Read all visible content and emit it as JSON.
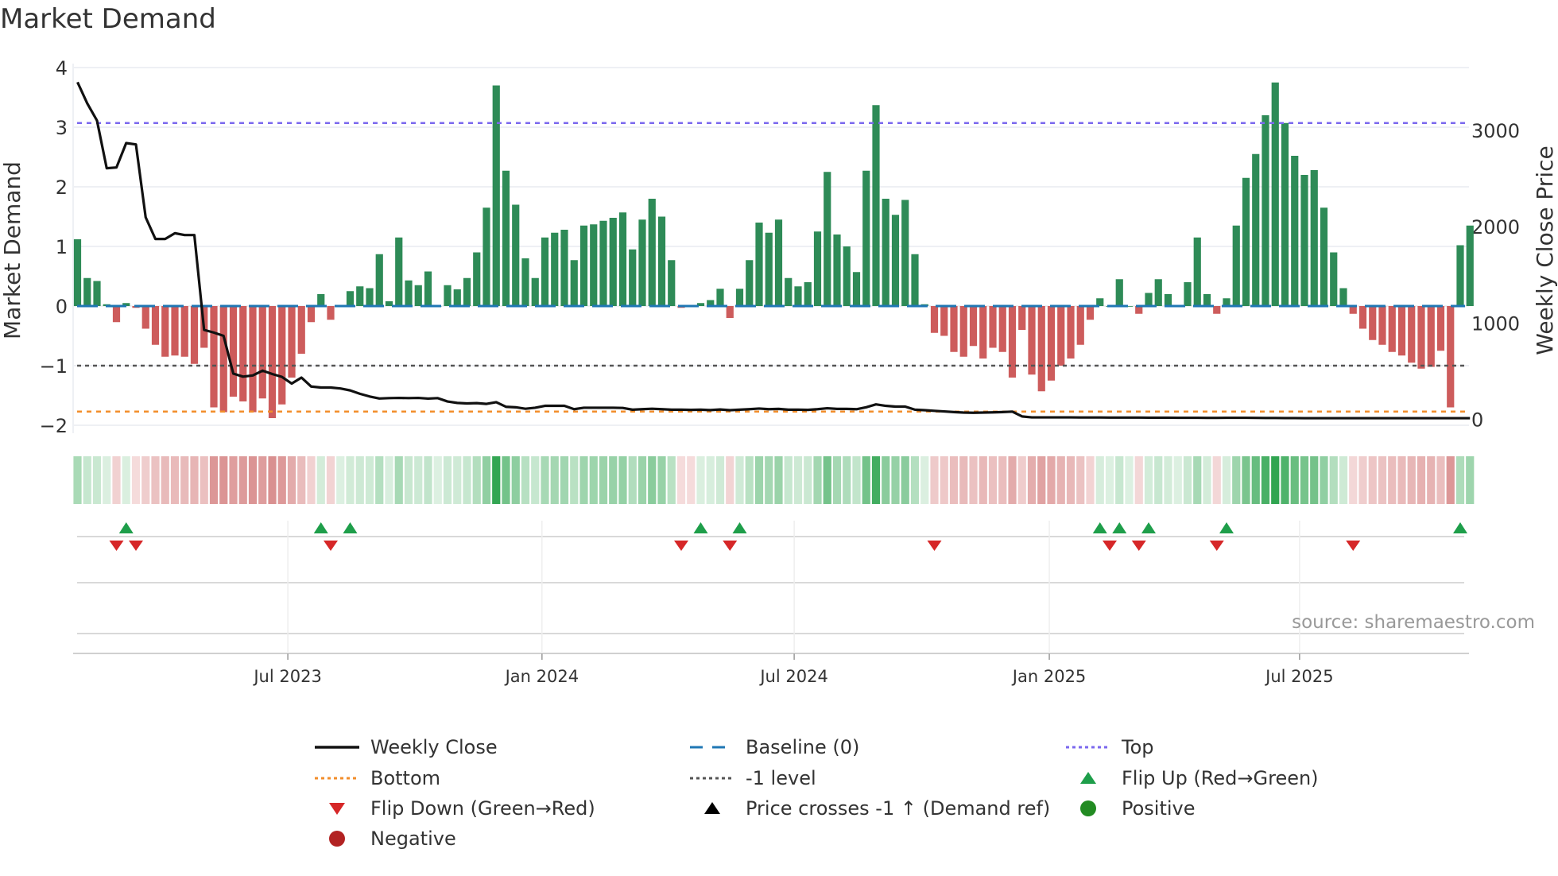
{
  "title": "Market Demand",
  "source": "source: sharemaestro.com",
  "colors": {
    "positive_bar": "#2e8b57",
    "negative_bar": "#cd5c5c",
    "price_line": "#111111",
    "baseline": "#1f77b4",
    "top": "#7b68ee",
    "bottom": "#f28e2b",
    "minus_one": "#555555",
    "flip_up": "#1e9e4a",
    "flip_down": "#d62728",
    "positive_dot": "#228b22",
    "negative_dot": "#b22222",
    "cross": "#000000"
  },
  "chart_data": {
    "type": "bar",
    "title": "Market Demand",
    "ylabel": "Market Demand",
    "y2label": "Weekly Close Price",
    "ylim": [
      -2.1,
      4.05
    ],
    "y2lim": [
      -150,
      4350
    ],
    "yticks": [
      4,
      3,
      2,
      1,
      0,
      -1,
      -2
    ],
    "ytick_labels": [
      "4",
      "3",
      "2",
      "1",
      "0",
      "−1",
      "−2"
    ],
    "y2ticks": [
      0,
      1000,
      2000,
      3000
    ],
    "y2tick_labels": [
      "0",
      "1000",
      "2000",
      "3000"
    ],
    "xticks": [
      {
        "label": "Jul 2023",
        "week": 21.6
      },
      {
        "label": "Jan 2024",
        "week": 47.7
      },
      {
        "label": "Jul 2024",
        "week": 73.6
      },
      {
        "label": "Jan 2025",
        "week": 99.8
      },
      {
        "label": "Jul 2025",
        "week": 125.5
      }
    ],
    "levels": {
      "top": 3.07,
      "bottom": -1.77,
      "minus_one": -1,
      "baseline": 0
    },
    "demand": [
      1.12,
      0.47,
      0.42,
      0.03,
      -0.27,
      0.05,
      -0.03,
      -0.38,
      -0.65,
      -0.85,
      -0.83,
      -0.85,
      -0.97,
      -0.7,
      -1.7,
      -1.78,
      -1.52,
      -1.6,
      -1.78,
      -1.55,
      -1.88,
      -1.65,
      -1.2,
      -0.8,
      -0.27,
      0.2,
      -0.23,
      0.0,
      0.25,
      0.33,
      0.3,
      0.87,
      0.08,
      1.15,
      0.43,
      0.35,
      0.58,
      0.0,
      0.35,
      0.28,
      0.47,
      0.9,
      1.65,
      3.7,
      2.27,
      1.7,
      0.8,
      0.47,
      1.15,
      1.23,
      1.28,
      0.77,
      1.35,
      1.37,
      1.43,
      1.48,
      1.57,
      0.95,
      1.45,
      1.8,
      1.5,
      0.77,
      -0.03,
      -0.02,
      0.05,
      0.1,
      0.29,
      -0.2,
      0.29,
      0.77,
      1.4,
      1.23,
      1.45,
      0.47,
      0.33,
      0.4,
      1.25,
      2.25,
      1.2,
      1.0,
      0.57,
      2.27,
      3.37,
      1.8,
      1.53,
      1.78,
      0.87,
      0.03,
      -0.45,
      -0.5,
      -0.77,
      -0.85,
      -0.67,
      -0.88,
      -0.7,
      -0.77,
      -1.2,
      -0.4,
      -1.15,
      -1.43,
      -1.25,
      -1.0,
      -0.88,
      -0.65,
      -0.23,
      0.13,
      0.0,
      0.45,
      0.0,
      -0.13,
      0.22,
      0.45,
      0.2,
      0.0,
      0.4,
      1.15,
      0.2,
      -0.13,
      0.13,
      1.35,
      2.15,
      2.55,
      3.2,
      3.75,
      3.07,
      2.52,
      2.2,
      2.28,
      1.65,
      0.9,
      0.3,
      -0.13,
      -0.38,
      -0.57,
      -0.65,
      -0.77,
      -0.83,
      -0.95,
      -1.05,
      -1.02,
      -0.75,
      -1.7,
      1.02,
      1.35
    ],
    "weekly_close": [
      3498,
      3278,
      3100,
      2605,
      2613,
      2866,
      2852,
      2096,
      1871,
      1871,
      1931,
      1912,
      1912,
      928,
      900,
      866,
      474,
      443,
      455,
      505,
      470,
      440,
      371,
      433,
      340,
      330,
      330,
      320,
      300,
      265,
      237,
      216,
      220,
      222,
      220,
      222,
      215,
      220,
      185,
      170,
      165,
      168,
      160,
      178,
      130,
      125,
      110,
      120,
      140,
      140,
      140,
      105,
      120,
      120,
      120,
      120,
      118,
      100,
      105,
      110,
      105,
      100,
      100,
      98,
      100,
      96,
      102,
      95,
      100,
      105,
      112,
      105,
      108,
      100,
      100,
      98,
      105,
      115,
      108,
      108,
      105,
      125,
      155,
      140,
      132,
      132,
      100,
      95,
      88,
      82,
      75,
      70,
      68,
      70,
      72,
      75,
      80,
      30,
      20,
      20,
      20,
      20,
      20,
      19,
      19,
      19,
      18,
      18,
      18,
      18,
      17,
      17,
      17,
      16,
      16,
      16,
      15,
      15,
      16,
      16,
      16,
      15,
      14,
      14,
      13,
      13,
      12,
      12,
      12,
      12,
      12,
      12,
      12,
      12,
      12,
      12,
      12,
      12,
      12,
      12,
      12,
      12,
      12,
      12
    ],
    "flip_up_weeks": [
      5,
      25,
      28,
      64,
      68,
      105,
      107,
      110,
      118,
      142
    ],
    "flip_down_weeks": [
      4,
      6,
      26,
      62,
      67,
      88,
      106,
      109,
      117,
      131
    ]
  },
  "legend": [
    {
      "label": "Weekly Close",
      "kind": "line"
    },
    {
      "label": "Baseline (0)",
      "kind": "dash"
    },
    {
      "label": "Top",
      "kind": "dot-top"
    },
    {
      "label": "Bottom",
      "kind": "dot-bottom"
    },
    {
      "label": "-1 level",
      "kind": "dot-minus"
    },
    {
      "label": "Flip Up (Red→Green)",
      "kind": "tri-up"
    },
    {
      "label": "Flip Down (Green→Red)",
      "kind": "tri-down"
    },
    {
      "label": "Price crosses -1 ↑ (Demand ref)",
      "kind": "tri-black"
    },
    {
      "label": "Positive",
      "kind": "dot-pos"
    },
    {
      "label": "Negative",
      "kind": "dot-neg"
    }
  ]
}
